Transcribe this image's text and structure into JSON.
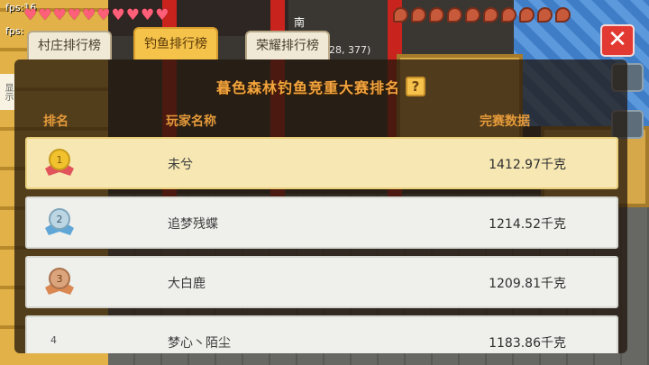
{
  "hud": {
    "fps_top": "fps:16",
    "fps_second": "fps:",
    "compass": "南",
    "coords": "28, 377)",
    "side_tab": "显示"
  },
  "tabs": [
    {
      "label": "村庄排行榜"
    },
    {
      "label": "钓鱼排行榜"
    },
    {
      "label": "荣耀排行榜"
    }
  ],
  "panel": {
    "title": "暮色森林钓鱼竞重大赛排名",
    "help": "?",
    "columns": {
      "rank": "排名",
      "player": "玩家名称",
      "score": "完赛数据"
    }
  },
  "rows": [
    {
      "rank": "1",
      "name": "未兮",
      "score": "1412.97千克",
      "medal_color": "#f2c12e"
    },
    {
      "rank": "2",
      "name": "追梦残蝶",
      "score": "1214.52千克",
      "medal_color": "#a9c9dc"
    },
    {
      "rank": "3",
      "name": "大白鹿",
      "score": "1209.81千克",
      "medal_color": "#d59b6e"
    },
    {
      "rank": "4",
      "name": "梦心丶陌尘",
      "score": "1183.86千克"
    }
  ],
  "close_label": "✕",
  "colors": {
    "accent": "#f2a43e",
    "close": "#e23a33",
    "active_tab": "#f5c24a"
  }
}
